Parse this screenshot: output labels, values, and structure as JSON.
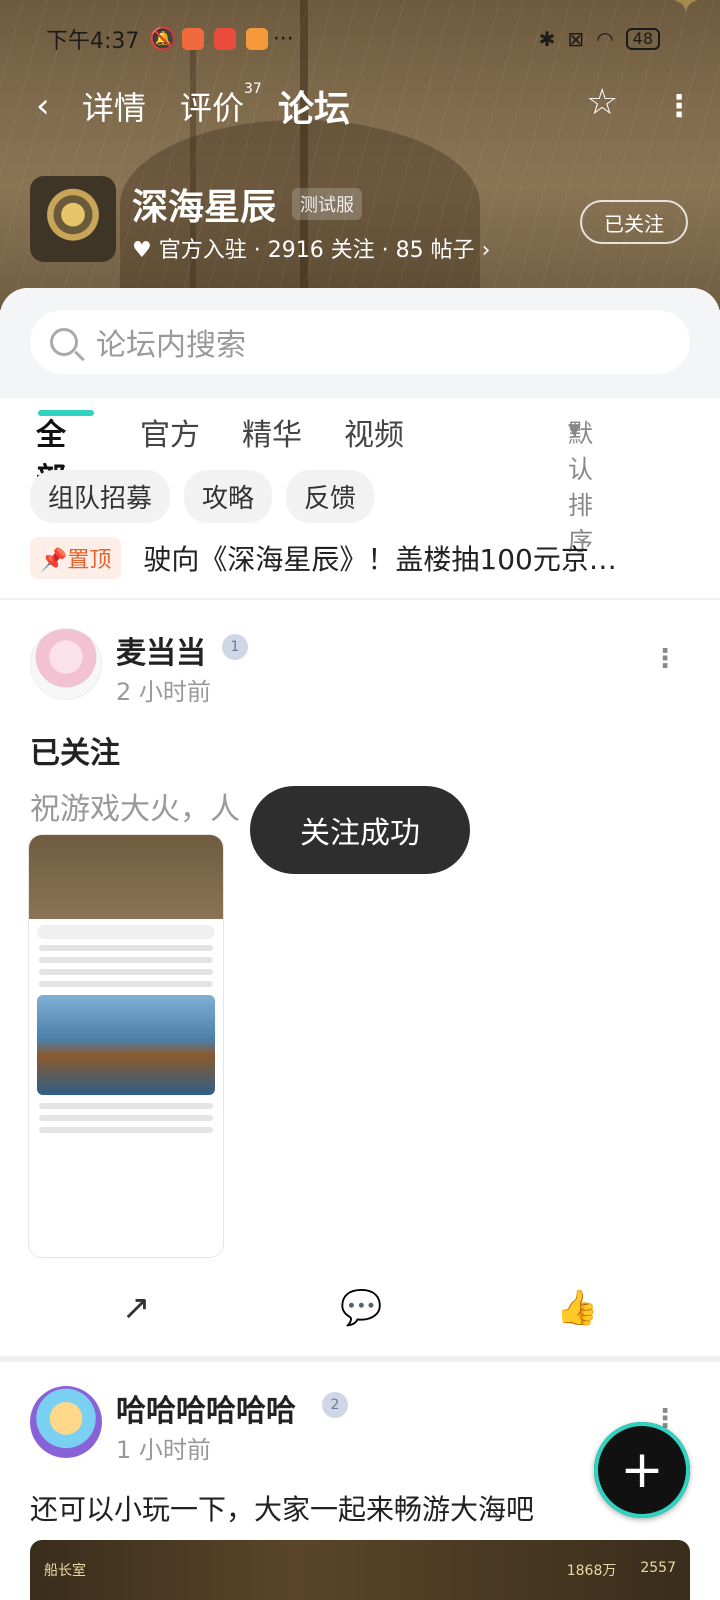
{
  "status": {
    "time": "下午4:37",
    "battery": "48"
  },
  "nav": {
    "tabs": [
      "详情",
      "评价",
      "论坛"
    ],
    "review_count": "37"
  },
  "game": {
    "name": "深海星辰",
    "badge": "测试服",
    "meta": "官方入驻 · 2916 关注 · 85 帖子",
    "follow_label": "已关注"
  },
  "search": {
    "placeholder": "论坛内搜索"
  },
  "filter_tabs": [
    "全部",
    "官方",
    "精华",
    "视频"
  ],
  "sort_label": "默认排序",
  "chips": [
    "组队招募",
    "攻略",
    "反馈"
  ],
  "pinned": {
    "badge": "置顶",
    "text": "驶向《深海星辰》！盖楼抽100元京…"
  },
  "posts": [
    {
      "user": "麦当当",
      "level": "1",
      "time": "2 小时前",
      "title": "已关注",
      "body": "祝游戏大火，人"
    },
    {
      "user": "哈哈哈哈哈哈",
      "level": "2",
      "time": "1 小时前",
      "body": "还可以小玩一下，大家一起来畅游大海吧"
    }
  ],
  "toast": "关注成功",
  "game_strip": {
    "left": "船长室",
    "stat1": "1868万",
    "stat2": "2557"
  },
  "colors": {
    "accent": "#2fd3c0",
    "pin": "#e8622e"
  }
}
